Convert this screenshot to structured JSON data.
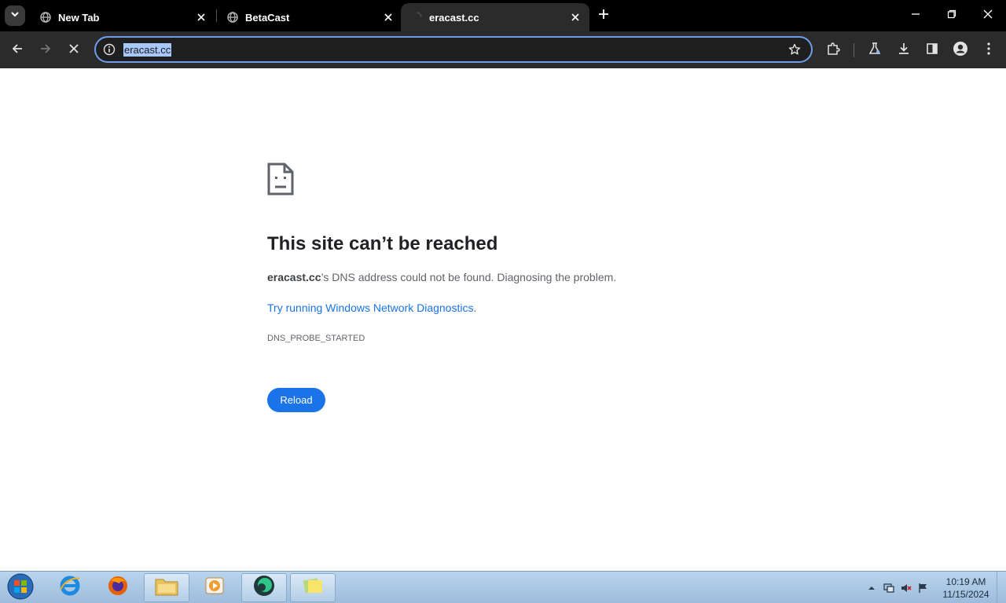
{
  "tabs": [
    {
      "title": "New Tab",
      "active": false
    },
    {
      "title": "BetaCast",
      "active": false
    },
    {
      "title": "eracast.cc",
      "active": true
    }
  ],
  "omnibox": {
    "url": "eracast.cc"
  },
  "error": {
    "title": "This site can’t be reached",
    "host": "eracast.cc",
    "message": "’s DNS address could not be found. Diagnosing the problem.",
    "link_text": "Try running Windows Network Diagnostics",
    "link_suffix": ".",
    "code": "DNS_PROBE_STARTED",
    "reload_label": "Reload"
  },
  "taskbar": {
    "items": [
      "internet-explorer",
      "firefox",
      "file-explorer",
      "media-player",
      "browser-app",
      "notes-app"
    ]
  },
  "clock": {
    "time": "10:19 AM",
    "date": "11/15/2024"
  },
  "colors": {
    "accent": "#1a73e8",
    "tabstrip": "#000000",
    "toolbar": "#2b2b2b",
    "omnibox_border": "#6e9eea"
  }
}
